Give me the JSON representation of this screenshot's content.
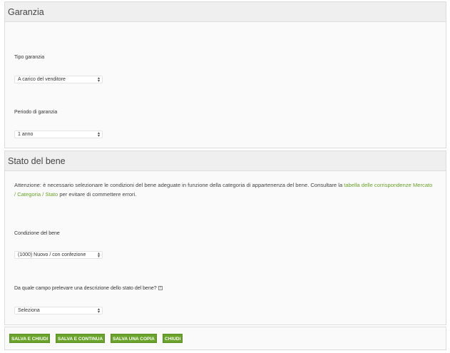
{
  "garanzia": {
    "title": "Garanzia",
    "tipo_label": "Tipo garanzia",
    "tipo_value": "A carico del venditore",
    "periodo_label": "Periodo di garanzia",
    "periodo_value": "1 anno"
  },
  "stato": {
    "title": "Stato del bene",
    "notice_pre": "Attenzione: è necessario selezionare le condizioni del bene adeguate in funzione della categoria di appartenenza del bene. Consultare la ",
    "notice_link": "tabella delle corrispondenze Mercato / Categoria / Stato",
    "notice_post": " per evitare di commettere errori.",
    "condizione_label": "Condizione del bene",
    "condizione_value": "(1000) Nuovo / con confezione",
    "descrizione_label": "Da quale campo prelevare una descrizione dello stato del bene?",
    "descrizione_value": "Seleziona"
  },
  "actions": {
    "salva_chiudi": "SALVA E CHIUDI",
    "salva_continua": "SALVA E CONTINUA",
    "salva_copia": "SALVA UNA COPIA",
    "chiudi": "CHIUDI"
  },
  "colors": {
    "accent": "#6aa329",
    "header_bg": "#efefef",
    "panel_bg": "#fafafa"
  }
}
